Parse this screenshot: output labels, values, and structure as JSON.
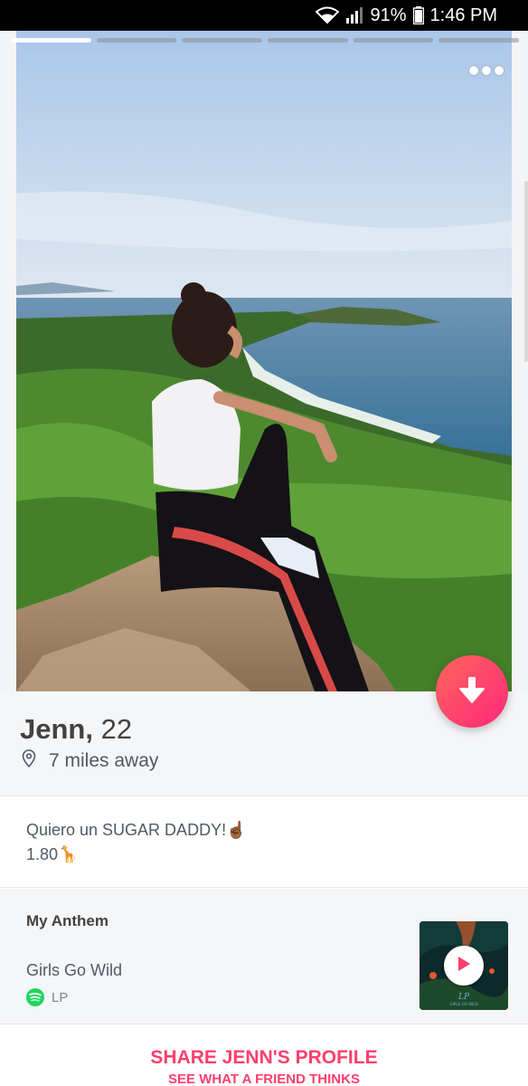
{
  "status_bar": {
    "battery": "91%",
    "time": "1:46 PM",
    "icons": [
      "wifi-icon",
      "signal-icon",
      "battery-icon"
    ]
  },
  "photo": {
    "count": 6,
    "current_index": 0,
    "description_icon": "photo"
  },
  "profile": {
    "name": "Jenn,",
    "age": "22",
    "distance": "7 miles away"
  },
  "bio": {
    "line1": "Quiero un SUGAR DADDY!☝🏾",
    "line2": "1.80🦒"
  },
  "anthem": {
    "title": "My Anthem",
    "song": "Girls Go Wild",
    "artist": "LP",
    "album_label": "LP",
    "album_sub": "GIRLS GO WILD"
  },
  "share": {
    "title": "SHARE JENN'S PROFILE",
    "subtitle": "SEE WHAT A FRIEND THINKS"
  },
  "colors": {
    "accent": "#fd3f6c",
    "gradient_start": "#ff655b",
    "gradient_end": "#fd297b",
    "spotify": "#1ed760"
  }
}
